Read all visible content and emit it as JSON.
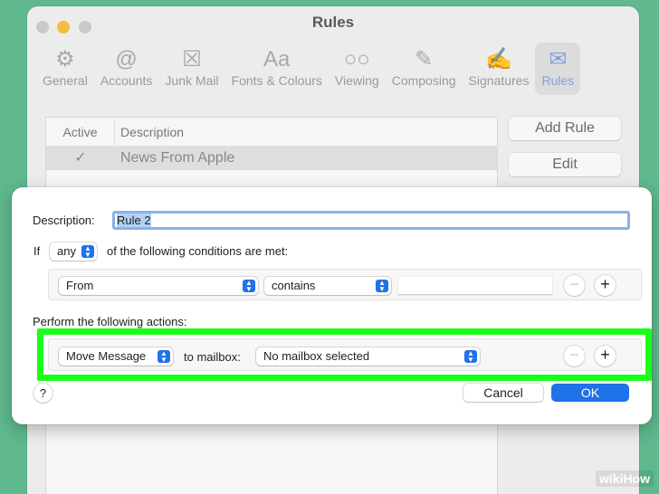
{
  "window": {
    "title": "Rules"
  },
  "toolbar": {
    "items": [
      {
        "label": "General",
        "icon": "gear-icon",
        "glyph": "⚙"
      },
      {
        "label": "Accounts",
        "icon": "at-icon",
        "glyph": "@"
      },
      {
        "label": "Junk Mail",
        "icon": "junk-mail-icon",
        "glyph": "☒"
      },
      {
        "label": "Fonts & Colours",
        "icon": "fonts-icon",
        "glyph": "Aa"
      },
      {
        "label": "Viewing",
        "icon": "glasses-icon",
        "glyph": "○○"
      },
      {
        "label": "Composing",
        "icon": "compose-icon",
        "glyph": "✎"
      },
      {
        "label": "Signatures",
        "icon": "signature-icon",
        "glyph": "✍"
      },
      {
        "label": "Rules",
        "icon": "rules-icon",
        "glyph": "✉"
      }
    ]
  },
  "rules_table": {
    "columns": [
      "Active",
      "Description"
    ],
    "rows": [
      {
        "active": "✓",
        "description": "News From Apple"
      }
    ]
  },
  "side_buttons": {
    "add_rule": "Add Rule",
    "edit": "Edit"
  },
  "sheet": {
    "description_label": "Description:",
    "description_value": "Rule 2",
    "if_label": "If",
    "match_value": "any",
    "conditions_suffix": "of the following conditions are met:",
    "condition": {
      "field": "From",
      "operator": "contains",
      "value": ""
    },
    "actions_label": "Perform the following actions:",
    "action": {
      "type": "Move Message",
      "to_label": "to mailbox:",
      "mailbox": "No mailbox selected"
    },
    "minus": "−",
    "plus": "+",
    "help": "?",
    "cancel": "Cancel",
    "ok": "OK"
  },
  "watermark": {
    "wiki": "wiki",
    "how": "How"
  },
  "colors": {
    "accent": "#1f72e8",
    "highlight": "#1aff1a",
    "background": "#5fb88e"
  }
}
